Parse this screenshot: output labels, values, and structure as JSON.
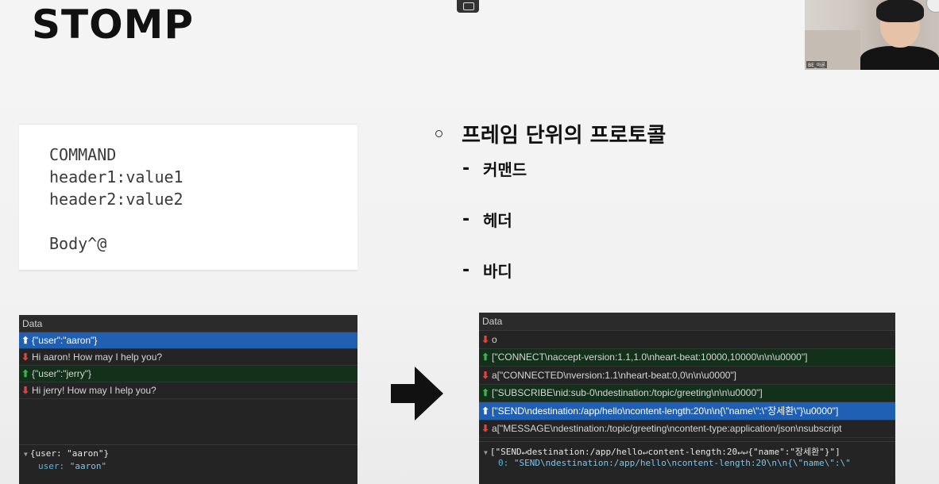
{
  "slide": {
    "title": "STOMP"
  },
  "webcam": {
    "name_label": "BE_아론"
  },
  "code_box": {
    "lines": [
      "COMMAND",
      "header1:value1",
      "header2:value2",
      "",
      "Body^@"
    ]
  },
  "bullets": {
    "main": "프레임 단위의 프로토콜",
    "subs": [
      "커맨드",
      "헤더",
      "바디"
    ],
    "dash": "-"
  },
  "left_devtools": {
    "header": "Data",
    "rows": [
      {
        "dir": "up",
        "text": "{\"user\":\"aaron\"}"
      },
      {
        "dir": "down",
        "text": "Hi aaron! How may I help you?"
      },
      {
        "dir": "up",
        "text": "{\"user\":\"jerry\"}"
      },
      {
        "dir": "down",
        "text": "Hi jerry! How may I help you?"
      }
    ],
    "detail_line1": "{user: \"aaron\"}",
    "detail_line2_key": "user: ",
    "detail_line2_val": "\"aaron\""
  },
  "right_devtools": {
    "header": "Data",
    "rows": [
      {
        "dir": "down",
        "text": "o"
      },
      {
        "dir": "up",
        "text": "[\"CONNECT\\naccept-version:1.1,1.0\\nheart-beat:10000,10000\\n\\n\\u0000\"]"
      },
      {
        "dir": "down",
        "text": "a[\"CONNECTED\\nversion:1.1\\nheart-beat:0,0\\n\\n\\u0000\"]"
      },
      {
        "dir": "up",
        "text": "[\"SUBSCRIBE\\nid:sub-0\\ndestination:/topic/greeting\\n\\n\\u0000\"]"
      },
      {
        "dir": "up",
        "text": "[\"SEND\\ndestination:/app/hello\\ncontent-length:20\\n\\n{\\\"name\\\":\\\"장세환\\\"}\\u0000\"]"
      },
      {
        "dir": "down",
        "text": "a[\"MESSAGE\\ndestination:/topic/greeting\\ncontent-type:application/json\\nsubscript"
      }
    ],
    "detail_line1": "[\"SEND↵destination:/app/hello↵content-length:20↵↵{\"name\":\"장세환\"}\"]",
    "detail_line2_key": "0: ",
    "detail_line2_val": "\"SEND\\ndestination:/app/hello\\ncontent-length:20\\n\\n{\\\"name\\\":\\\""
  },
  "colors": {
    "sent_row": "#12301a",
    "selected_row": "#1f5fb4",
    "up_arrow": "#3fb050",
    "down_arrow": "#e0453d"
  }
}
